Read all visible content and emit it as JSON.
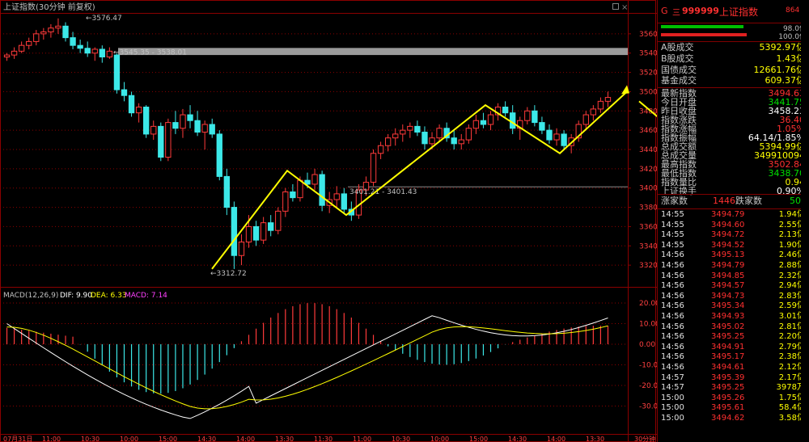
{
  "chart_header": {
    "title": "上证指数(30分钟 前复权)",
    "window_icons": [
      "square-icon",
      "close-icon"
    ]
  },
  "macd_header": {
    "label": "MACD(12,26,9)",
    "dif": "DIF: 9.90",
    "dea": "DEA: 6.33",
    "macd": "MACD: 7.14"
  },
  "price_axis": [
    "3560",
    "3540",
    "3520",
    "3500",
    "3480",
    "3460",
    "3440",
    "3420",
    "3400",
    "3380",
    "3360",
    "3340",
    "3320"
  ],
  "macd_axis": [
    "20.00",
    "10.00",
    "0.00",
    "-10.00",
    "-20.00",
    "-30.00"
  ],
  "time_axis": [
    "07月31日",
    "11:00",
    "10:30",
    "10:00",
    "15:00",
    "14:30",
    "14:00",
    "13:30",
    "11:30",
    "11:00",
    "10:30",
    "10:00",
    "15:00",
    "14:30",
    "14:00",
    "13:30",
    "30分钟"
  ],
  "annotations": {
    "high": "3576.47",
    "gap": "3545.35 - 3538.01",
    "low": "3312.72",
    "support": "3401.21 - 3401.43"
  },
  "quote": {
    "code_prefix": "G",
    "code_mark": "三",
    "code": "999999",
    "name": "上证指数",
    "badge": "864",
    "ratio1": "98.0亿",
    "ratio2": "100.0亿"
  },
  "stats_top": [
    {
      "k": "A股成交",
      "v": "5392.97亿",
      "color": "#ffff00"
    },
    {
      "k": "B股成交",
      "v": "1.43亿",
      "color": "#ffff00"
    },
    {
      "k": "国债成交",
      "v": "12661.76亿",
      "color": "#ffff00"
    },
    {
      "k": "基金成交",
      "v": "609.37亿",
      "color": "#ffff00"
    }
  ],
  "stats_mid": [
    {
      "k": "最新指数",
      "v": "3494.63",
      "color": "#ff3030"
    },
    {
      "k": "今日开盘",
      "v": "3441.75",
      "color": "#00e000"
    },
    {
      "k": "昨日收盘",
      "v": "3458.23",
      "color": "#ffffff"
    },
    {
      "k": "指数涨跌",
      "v": "36.40",
      "color": "#ff3030"
    },
    {
      "k": "指数涨幅",
      "v": "1.05%",
      "color": "#ff3030"
    },
    {
      "k": "指数振幅",
      "v": "64.14/1.85%",
      "color": "#ffffff"
    },
    {
      "k": "总成交额",
      "v": "5394.99亿",
      "color": "#ffff00"
    },
    {
      "k": "总成交量",
      "v": "349910094",
      "color": "#ffff00"
    },
    {
      "k": "最高指数",
      "v": "3502.84",
      "color": "#ff3030"
    },
    {
      "k": "最低指数",
      "v": "3438.70",
      "color": "#00e000"
    },
    {
      "k": "指数量比",
      "v": "0.94",
      "color": "#ffff00"
    },
    {
      "k": "上证换手",
      "v": "0.90%",
      "color": "#ffffff"
    }
  ],
  "breadth": {
    "up_label": "涨家数",
    "up": "1446",
    "down_label": "跌家数",
    "down": "501"
  },
  "trades": [
    {
      "t": "14:55",
      "p": "3494.79",
      "v": "1.94亿"
    },
    {
      "t": "14:55",
      "p": "3494.60",
      "v": "2.55亿"
    },
    {
      "t": "14:55",
      "p": "3494.72",
      "v": "2.13亿"
    },
    {
      "t": "14:55",
      "p": "3494.52",
      "v": "1.90亿"
    },
    {
      "t": "14:56",
      "p": "3495.13",
      "v": "2.46亿"
    },
    {
      "t": "14:56",
      "p": "3494.79",
      "v": "2.88亿"
    },
    {
      "t": "14:56",
      "p": "3494.85",
      "v": "2.32亿"
    },
    {
      "t": "14:56",
      "p": "3494.57",
      "v": "2.94亿"
    },
    {
      "t": "14:56",
      "p": "3494.73",
      "v": "2.83亿"
    },
    {
      "t": "14:56",
      "p": "3495.34",
      "v": "2.59亿"
    },
    {
      "t": "14:56",
      "p": "3494.93",
      "v": "3.01亿"
    },
    {
      "t": "14:56",
      "p": "3495.02",
      "v": "2.81亿"
    },
    {
      "t": "14:56",
      "p": "3495.25",
      "v": "2.20亿"
    },
    {
      "t": "14:56",
      "p": "3494.91",
      "v": "2.79亿"
    },
    {
      "t": "14:56",
      "p": "3495.17",
      "v": "2.38亿"
    },
    {
      "t": "14:56",
      "p": "3494.61",
      "v": "2.12亿"
    },
    {
      "t": "14:57",
      "p": "3495.39",
      "v": "2.17亿"
    },
    {
      "t": "14:57",
      "p": "3495.25",
      "v": "3978万"
    },
    {
      "t": "15:00",
      "p": "3495.26",
      "v": "1.75亿"
    },
    {
      "t": "15:00",
      "p": "3495.61",
      "v": "58.4亿"
    },
    {
      "t": "15:00",
      "p": "3494.62",
      "v": "3.58亿"
    }
  ],
  "colors": {
    "up": "#ff3a3a",
    "down": "#3ce8e8",
    "grid": "#8b0000",
    "dif": "#ffffff",
    "dea": "#ffff00",
    "trend": "#ffff00"
  },
  "chart_data": {
    "type": "candlestick",
    "ylim": [
      3300,
      3580
    ],
    "candles": [
      [
        3536,
        3540,
        3532,
        3538
      ],
      [
        3538,
        3546,
        3534,
        3542
      ],
      [
        3542,
        3552,
        3540,
        3548
      ],
      [
        3548,
        3556,
        3544,
        3552
      ],
      [
        3552,
        3564,
        3548,
        3560
      ],
      [
        3560,
        3566,
        3554,
        3562
      ],
      [
        3562,
        3570,
        3556,
        3566
      ],
      [
        3566,
        3576,
        3560,
        3568
      ],
      [
        3568,
        3572,
        3552,
        3556
      ],
      [
        3556,
        3562,
        3544,
        3548
      ],
      [
        3548,
        3554,
        3540,
        3545
      ],
      [
        3545,
        3552,
        3536,
        3540
      ],
      [
        3540,
        3546,
        3532,
        3544
      ],
      [
        3544,
        3548,
        3530,
        3536
      ],
      [
        3536,
        3546,
        3534,
        3542
      ],
      [
        3538,
        3540,
        3498,
        3502
      ],
      [
        3502,
        3510,
        3490,
        3496
      ],
      [
        3496,
        3500,
        3474,
        3478
      ],
      [
        3478,
        3488,
        3468,
        3484
      ],
      [
        3484,
        3486,
        3452,
        3456
      ],
      [
        3456,
        3470,
        3450,
        3464
      ],
      [
        3464,
        3468,
        3428,
        3432
      ],
      [
        3432,
        3472,
        3428,
        3468
      ],
      [
        3468,
        3480,
        3456,
        3462
      ],
      [
        3462,
        3482,
        3452,
        3476
      ],
      [
        3476,
        3486,
        3462,
        3470
      ],
      [
        3470,
        3480,
        3454,
        3458
      ],
      [
        3458,
        3470,
        3440,
        3466
      ],
      [
        3466,
        3472,
        3452,
        3456
      ],
      [
        3456,
        3460,
        3408,
        3412
      ],
      [
        3412,
        3420,
        3372,
        3380
      ],
      [
        3380,
        3386,
        3316,
        3330
      ],
      [
        3330,
        3352,
        3320,
        3344
      ],
      [
        3344,
        3372,
        3338,
        3360
      ],
      [
        3360,
        3366,
        3340,
        3346
      ],
      [
        3346,
        3370,
        3342,
        3364
      ],
      [
        3364,
        3372,
        3350,
        3356
      ],
      [
        3356,
        3380,
        3352,
        3376
      ],
      [
        3376,
        3400,
        3370,
        3396
      ],
      [
        3396,
        3404,
        3386,
        3390
      ],
      [
        3390,
        3412,
        3386,
        3408
      ],
      [
        3408,
        3416,
        3400,
        3404
      ],
      [
        3404,
        3420,
        3398,
        3414
      ],
      [
        3414,
        3418,
        3376,
        3382
      ],
      [
        3382,
        3396,
        3374,
        3388
      ],
      [
        3388,
        3402,
        3380,
        3394
      ],
      [
        3394,
        3400,
        3374,
        3378
      ],
      [
        3378,
        3386,
        3366,
        3372
      ],
      [
        3372,
        3404,
        3368,
        3398
      ],
      [
        3398,
        3412,
        3392,
        3406
      ],
      [
        3406,
        3440,
        3402,
        3436
      ],
      [
        3436,
        3448,
        3430,
        3444
      ],
      [
        3444,
        3456,
        3438,
        3452
      ],
      [
        3452,
        3462,
        3444,
        3456
      ],
      [
        3456,
        3466,
        3448,
        3460
      ],
      [
        3460,
        3468,
        3452,
        3464
      ],
      [
        3464,
        3470,
        3454,
        3458
      ],
      [
        3458,
        3464,
        3440,
        3446
      ],
      [
        3446,
        3458,
        3440,
        3452
      ],
      [
        3452,
        3466,
        3448,
        3462
      ],
      [
        3462,
        3468,
        3448,
        3452
      ],
      [
        3452,
        3460,
        3440,
        3446
      ],
      [
        3446,
        3456,
        3440,
        3450
      ],
      [
        3450,
        3466,
        3446,
        3462
      ],
      [
        3462,
        3476,
        3456,
        3470
      ],
      [
        3470,
        3478,
        3462,
        3466
      ],
      [
        3466,
        3480,
        3460,
        3476
      ],
      [
        3476,
        3488,
        3470,
        3484
      ],
      [
        3484,
        3490,
        3474,
        3478
      ],
      [
        3478,
        3486,
        3456,
        3462
      ],
      [
        3462,
        3474,
        3450,
        3470
      ],
      [
        3470,
        3484,
        3466,
        3480
      ],
      [
        3480,
        3486,
        3464,
        3468
      ],
      [
        3468,
        3474,
        3456,
        3460
      ],
      [
        3460,
        3466,
        3446,
        3450
      ],
      [
        3450,
        3462,
        3444,
        3456
      ],
      [
        3456,
        3460,
        3440,
        3444
      ],
      [
        3444,
        3456,
        3436,
        3452
      ],
      [
        3452,
        3470,
        3448,
        3466
      ],
      [
        3466,
        3480,
        3460,
        3476
      ],
      [
        3476,
        3486,
        3470,
        3482
      ],
      [
        3482,
        3494,
        3478,
        3490
      ],
      [
        3490,
        3500,
        3484,
        3494
      ]
    ]
  }
}
